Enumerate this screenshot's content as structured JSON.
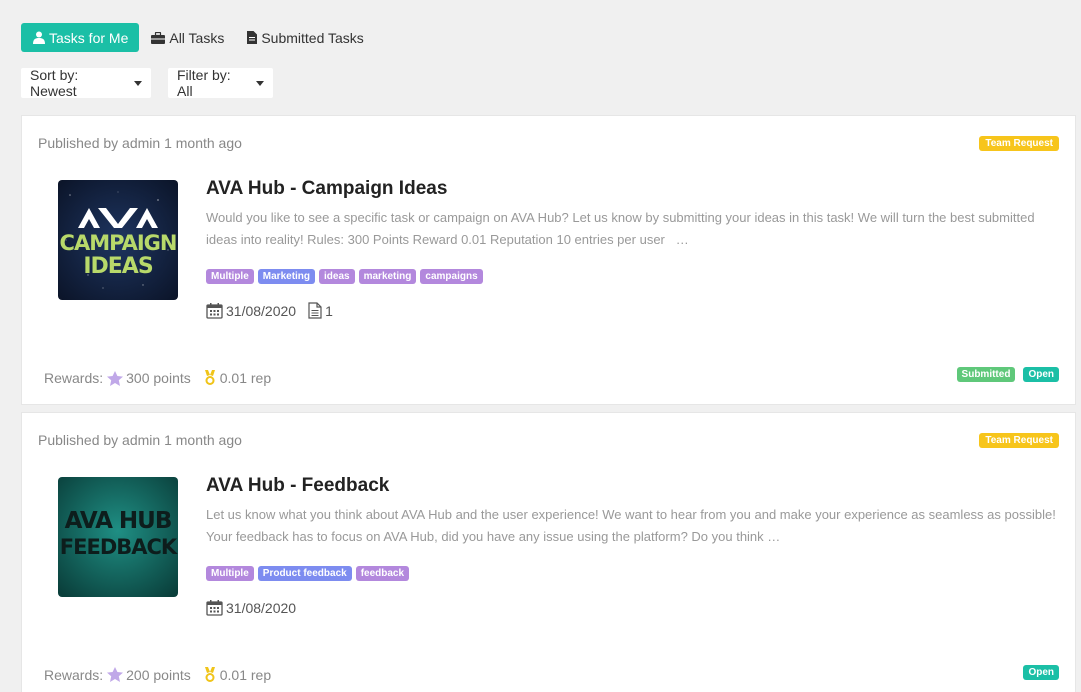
{
  "tabs": [
    {
      "label": "Tasks for Me",
      "icon": "user-icon",
      "active": true
    },
    {
      "label": "All Tasks",
      "icon": "briefcase-icon",
      "active": false
    },
    {
      "label": "Submitted Tasks",
      "icon": "document-icon",
      "active": false
    }
  ],
  "filters": {
    "sort_label": "Sort by: Newest",
    "filter_label": "Filter by: All"
  },
  "tasks": [
    {
      "published": "Published by admin 1 month ago",
      "type_badge": "Team Request",
      "title": "AVA Hub - Campaign Ideas",
      "description": "Would you like to see a specific task or campaign on AVA Hub? Let us know by submitting your ideas in this task! We will turn the best submitted ideas into reality! Rules: 300 Points Reward 0.01 Reputation 10 entries per user   …",
      "image_text": [
        "CAMPAIGN",
        "IDEAS"
      ],
      "tags": [
        "Multiple",
        "Marketing",
        "ideas",
        "marketing",
        "campaigns"
      ],
      "date": "31/08/2020",
      "submissions": "1",
      "rewards_label": "Rewards:",
      "points": "300 points",
      "rep": "0.01 rep",
      "statuses": [
        "Submitted",
        "Open"
      ]
    },
    {
      "published": "Published by admin 1 month ago",
      "type_badge": "Team Request",
      "title": "AVA Hub - Feedback",
      "description": "Let us know what you think about AVA Hub and the user experience! We want to hear from you and make your experience as seamless as possible! Your feedback has to focus on AVA Hub, did you have any issue using the platform? Do you think …",
      "image_text": [
        "AVA HUB",
        "FEEDBACK"
      ],
      "tags": [
        "Multiple",
        "Product feedback",
        "feedback"
      ],
      "date": "31/08/2020",
      "rewards_label": "Rewards:",
      "points": "200 points",
      "rep": "0.01 rep",
      "statuses": [
        "Open"
      ]
    }
  ],
  "colors": {
    "accent": "#1bbfa6",
    "team_badge": "#f7c51b",
    "tag_purple": "#b388dd",
    "tag_blue": "#7d8cf0",
    "submitted": "#5fc87a"
  }
}
